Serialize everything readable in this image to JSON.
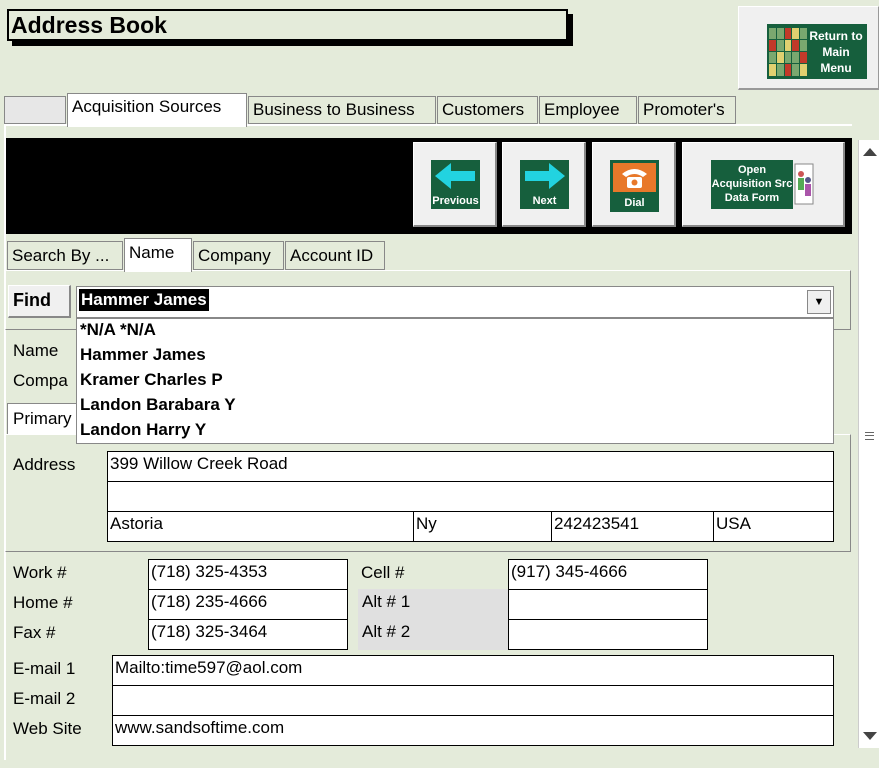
{
  "window": {
    "title": "Address Book"
  },
  "return_button": {
    "label_lines": [
      "Return to",
      "Main",
      "Menu"
    ]
  },
  "tabs": [
    "Acquisition Sources",
    "Business to Business",
    "Customers",
    "Employee",
    "Promoter's"
  ],
  "toolbar": {
    "previous": "Previous",
    "next": "Next",
    "dial": "Dial",
    "open_form_lines": [
      "Open",
      "Acquisition Src",
      "Data  Form"
    ]
  },
  "search_tabs": [
    "Search By ...",
    "Name",
    "Company",
    "Account ID"
  ],
  "find": {
    "label": "Find",
    "value": "Hammer James",
    "options": [
      "*N/A *N/A",
      "Hammer James",
      "Kramer Charles P",
      "Landon Barabara Y",
      "Landon Harry Y"
    ]
  },
  "labels": {
    "name": "Name",
    "company": "Compa",
    "primary": "Primary",
    "address": "Address",
    "work": "Work #",
    "home": "Home #",
    "fax": "Fax #",
    "cell": "Cell #",
    "alt1": "Alt # 1",
    "alt2": "Alt # 2",
    "email1": "E-mail 1",
    "email2": "E-mail  2",
    "website": "Web Site"
  },
  "address": {
    "line1": "399 Willow Creek Road",
    "line2": "",
    "city": "Astoria",
    "state": "Ny",
    "zip": "242423541",
    "country": "USA"
  },
  "phones": {
    "work": "(718) 325-4353",
    "home": "(718) 235-4666",
    "fax": "(718) 325-3464",
    "cell": "(917) 345-4666",
    "alt1": "",
    "alt2": ""
  },
  "contact": {
    "email1": "Mailto:time597@aol.com",
    "email2": "",
    "website": "www.sandsoftime.com"
  },
  "colors": {
    "background": "#e4ebda",
    "icon_green": "#165f3d",
    "arrow_cyan": "#22d3e0",
    "dial_orange": "#e8782a"
  }
}
